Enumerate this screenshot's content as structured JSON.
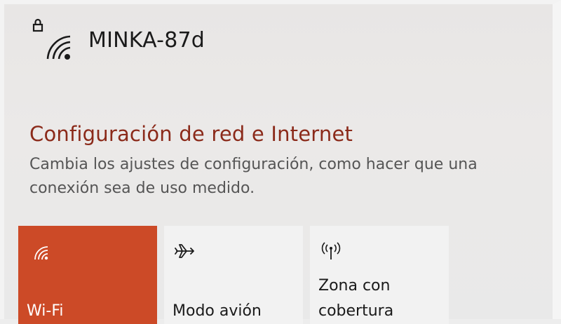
{
  "network": {
    "name": "MINKA-87d",
    "icon": "wifi-lock-icon"
  },
  "settings": {
    "title": "Configuración de red e Internet",
    "description_line1": "Cambia los ajustes de configuración, como hacer que una",
    "description_line2": "conexión sea de uso medido."
  },
  "tiles": [
    {
      "label": "Wi-Fi",
      "icon": "wifi-icon",
      "active": true
    },
    {
      "label": "Modo avión",
      "icon": "airplane-icon",
      "active": false
    },
    {
      "label_line1": "Zona con",
      "label_line2": "cobertura",
      "icon": "hotspot-icon",
      "active": false
    }
  ],
  "colors": {
    "accent": "#cc4a27",
    "title": "#8b2a1a",
    "tile_bg": "#f2f2f2"
  }
}
